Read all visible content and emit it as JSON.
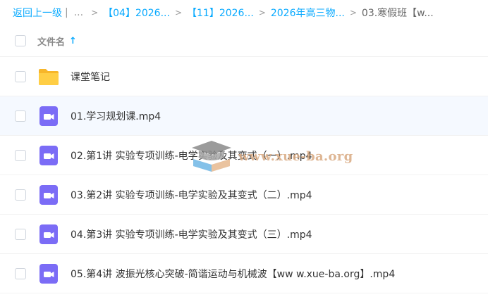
{
  "breadcrumb": {
    "back": "返回上一级",
    "divider": "|",
    "ellipsis": "...",
    "crumbs": [
      "【04】2026...",
      "【11】2026...",
      "2026年高三物..."
    ],
    "current": "03.寒假班【w..."
  },
  "header": {
    "column_name": "文件名",
    "sort_icon": "arrow-up-icon"
  },
  "files": [
    {
      "name": "课堂笔记",
      "type": "folder"
    },
    {
      "name": "01.学习规划课.mp4",
      "type": "video"
    },
    {
      "name": "02.第1讲 实验专项训练-电学实验及其变式（一）.mp4",
      "type": "video"
    },
    {
      "name": "03.第2讲 实验专项训练-电学实验及其变式（二）.mp4",
      "type": "video"
    },
    {
      "name": "04.第3讲 实验专项训练-电学实验及其变式（三）.mp4",
      "type": "video"
    },
    {
      "name": "05.第4讲 波振光核心突破-简谐运动与机械波【ww w.xue-ba.org】.mp4",
      "type": "video"
    }
  ],
  "watermark": {
    "text": "www.xue-ba.org"
  },
  "colors": {
    "accent": "#09AAFF",
    "folder": "#FFC93D",
    "video": "#7B6CF6",
    "hover_row": "#F5F9FF"
  }
}
